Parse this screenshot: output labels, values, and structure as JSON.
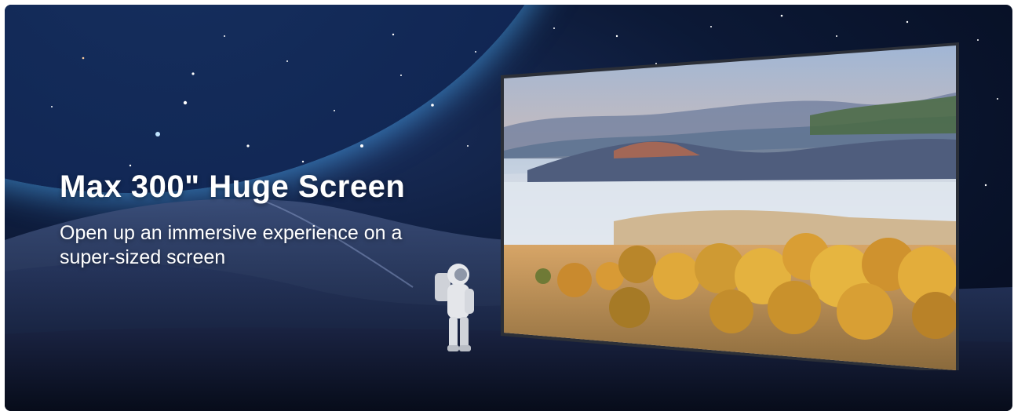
{
  "banner": {
    "headline": "Max 300\" Huge Screen",
    "subline": "Open up an immersive experience on a super-sized screen"
  },
  "colors": {
    "space": "#0c1936",
    "planet_glow": "#63c7ff",
    "text": "#ffffff"
  },
  "images": {
    "screen": "landscape-photo-on-projector-screen",
    "figure": "astronaut"
  }
}
